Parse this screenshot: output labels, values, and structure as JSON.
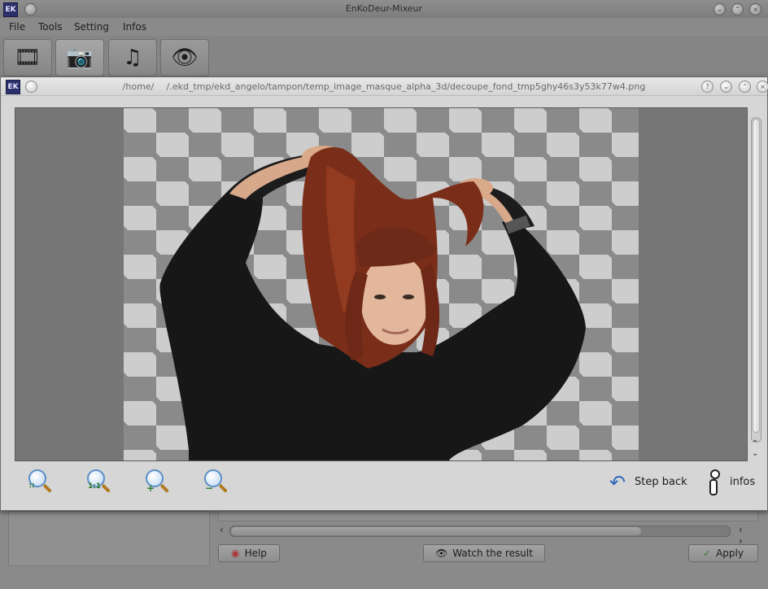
{
  "main_window": {
    "title": "EnKoDeur-Mixeur",
    "app_icon": "ekd-app-icon",
    "menu": [
      "File",
      "Tools",
      "Setting",
      "Infos"
    ],
    "toolbar": [
      {
        "icon": "film-reel-icon"
      },
      {
        "icon": "camera-icon"
      },
      {
        "icon": "music-speaker-icon"
      },
      {
        "icon": "eye-icon"
      }
    ],
    "buttons": {
      "help": "Help",
      "watch_result": "Watch the result",
      "apply": "Apply"
    }
  },
  "viewer": {
    "title": "/home/       /.ekd_tmp/ekd_angelo/tampon/temp_image_masque_alpha_3d/decoupe_fond_tmp5ghy46s3y53k77w4.png",
    "image_icon": "transparent-background-image",
    "zoom_buttons": [
      {
        "name": "zoom-fit",
        "mark": "∷"
      },
      {
        "name": "zoom-actual",
        "mark": "1:1"
      },
      {
        "name": "zoom-in",
        "mark": "+"
      },
      {
        "name": "zoom-out",
        "mark": "−"
      }
    ],
    "step_back_label": "Step back",
    "infos_label": "infos",
    "vertical_scroll_fraction": 0.97,
    "horizontal_scroll_fraction": 0.82
  },
  "colors": {
    "checker_dark": "#8a8a8a",
    "checker_light": "#cdcdcd",
    "dialog_bg": "#d6d6d6",
    "accent_blue": "#2f66b8"
  }
}
